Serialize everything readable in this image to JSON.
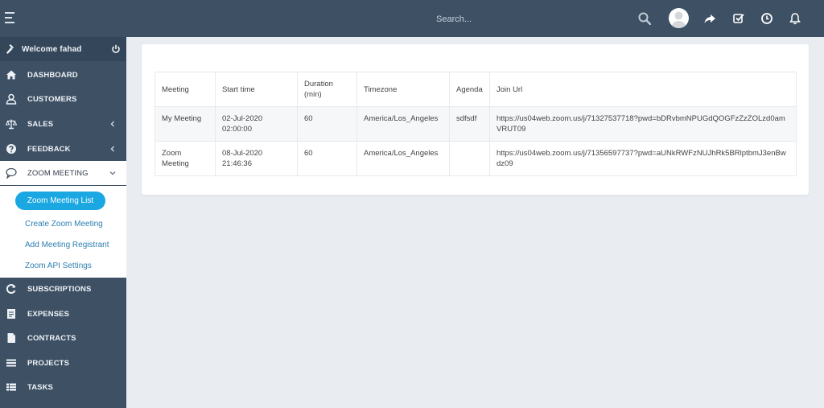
{
  "header": {
    "search_placeholder": "Search..."
  },
  "sidebar": {
    "welcome": "Welcome fahad",
    "items": [
      {
        "label": "DASHBOARD",
        "icon": "home-icon"
      },
      {
        "label": "CUSTOMERS",
        "icon": "user-icon"
      },
      {
        "label": "SALES",
        "icon": "balance-scale-icon"
      },
      {
        "label": "FEEDBACK",
        "icon": "question-circle-icon"
      },
      {
        "label": "ZOOM MEETING",
        "icon": "chat-bubble-icon"
      },
      {
        "label": "SUBSCRIPTIONS",
        "icon": "refresh-icon"
      },
      {
        "label": "EXPENSES",
        "icon": "document-icon"
      },
      {
        "label": "CONTRACTS",
        "icon": "file-icon"
      },
      {
        "label": "PROJECTS",
        "icon": "bars-icon"
      },
      {
        "label": "TASKS",
        "icon": "tasks-icon"
      }
    ],
    "submenu": {
      "active": "Zoom Meeting List",
      "items": [
        "Create Zoom Meeting",
        "Add Meeting Registrant",
        "Zoom API Settings"
      ]
    }
  },
  "table": {
    "headers": {
      "meeting": "Meeting",
      "start": "Start time",
      "duration": "Duration (min)",
      "timezone": "Timezone",
      "agenda": "Agenda",
      "join": "Join Url"
    },
    "rows": [
      {
        "meeting": "My Meeting",
        "start": "02-Jul-2020 02:00:00",
        "duration": "60",
        "timezone": "America/Los_Angeles",
        "agenda": "sdfsdf",
        "join": "https://us04web.zoom.us/j/71327537718?pwd=bDRvbmNPUGdQOGFzZzZOLzd0amVRUT09"
      },
      {
        "meeting": "Zoom Meeting",
        "start": "08-Jul-2020 21:46:36",
        "duration": "60",
        "timezone": "America/Los_Angeles",
        "agenda": "",
        "join": "https://us04web.zoom.us/j/71356597737?pwd=aUNkRWFzNUJhRk5BRlptbmJ3enBwdz09"
      }
    ]
  },
  "colors": {
    "topbar": "#3d5064",
    "sidebar": "#3d5064",
    "accent": "#1aa7e2",
    "background": "#e9edf2"
  }
}
